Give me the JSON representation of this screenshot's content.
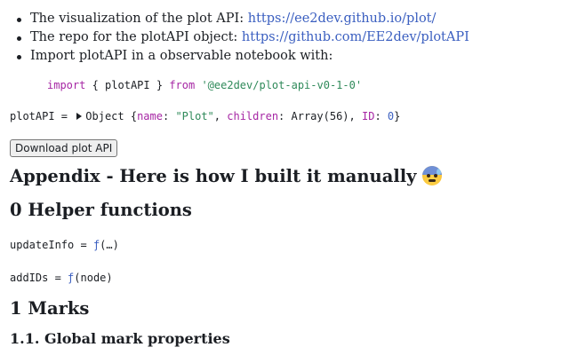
{
  "intro": {
    "items": [
      {
        "text": "The visualization of the plot API: ",
        "link": "https://ee2dev.github.io/plot/"
      },
      {
        "text": "The repo for the plotAPI object: ",
        "link": "https://github.com/EE2dev/plotAPI"
      },
      {
        "text": "Import plotAPI in a observable notebook with:"
      }
    ]
  },
  "import_code": {
    "kw_import": "import",
    "brace_open": " { ",
    "name": "plotAPI",
    "brace_close": " } ",
    "kw_from": "from",
    "source": "'@ee2dev/plot-api-v0-1-0'"
  },
  "plotapi_cell": {
    "var": "plotAPI",
    "eq": " = ",
    "type": "Object",
    "open": " {",
    "name_key": "name",
    "colon1": ": ",
    "name_val": "\"Plot\"",
    "sep1": ", ",
    "children_key": "children",
    "colon2": ": ",
    "children_val": "Array(56)",
    "sep2": ", ",
    "id_key": "ID",
    "colon3": ": ",
    "id_val": "0",
    "close": "}"
  },
  "download_button": {
    "label": "Download plot API"
  },
  "headings": {
    "appendix": "Appendix - Here is how I built it manually",
    "emoji": "anxious-face-with-sweat",
    "helpers": "0 Helper functions",
    "marks": "1 Marks",
    "global": "1.1. Global mark properties"
  },
  "cells": {
    "update_var": "updateInfo",
    "update_eq": " = ",
    "update_fn": "ƒ",
    "update_args": "(…)",
    "add_var": "addIDs",
    "add_eq": " = ",
    "add_fn": "ƒ",
    "add_args": "(node)"
  },
  "colors": {
    "link": "#3b5fc0",
    "keyword": "#a626a4",
    "string": "#2f8a5a",
    "text": "#1b1e23"
  }
}
